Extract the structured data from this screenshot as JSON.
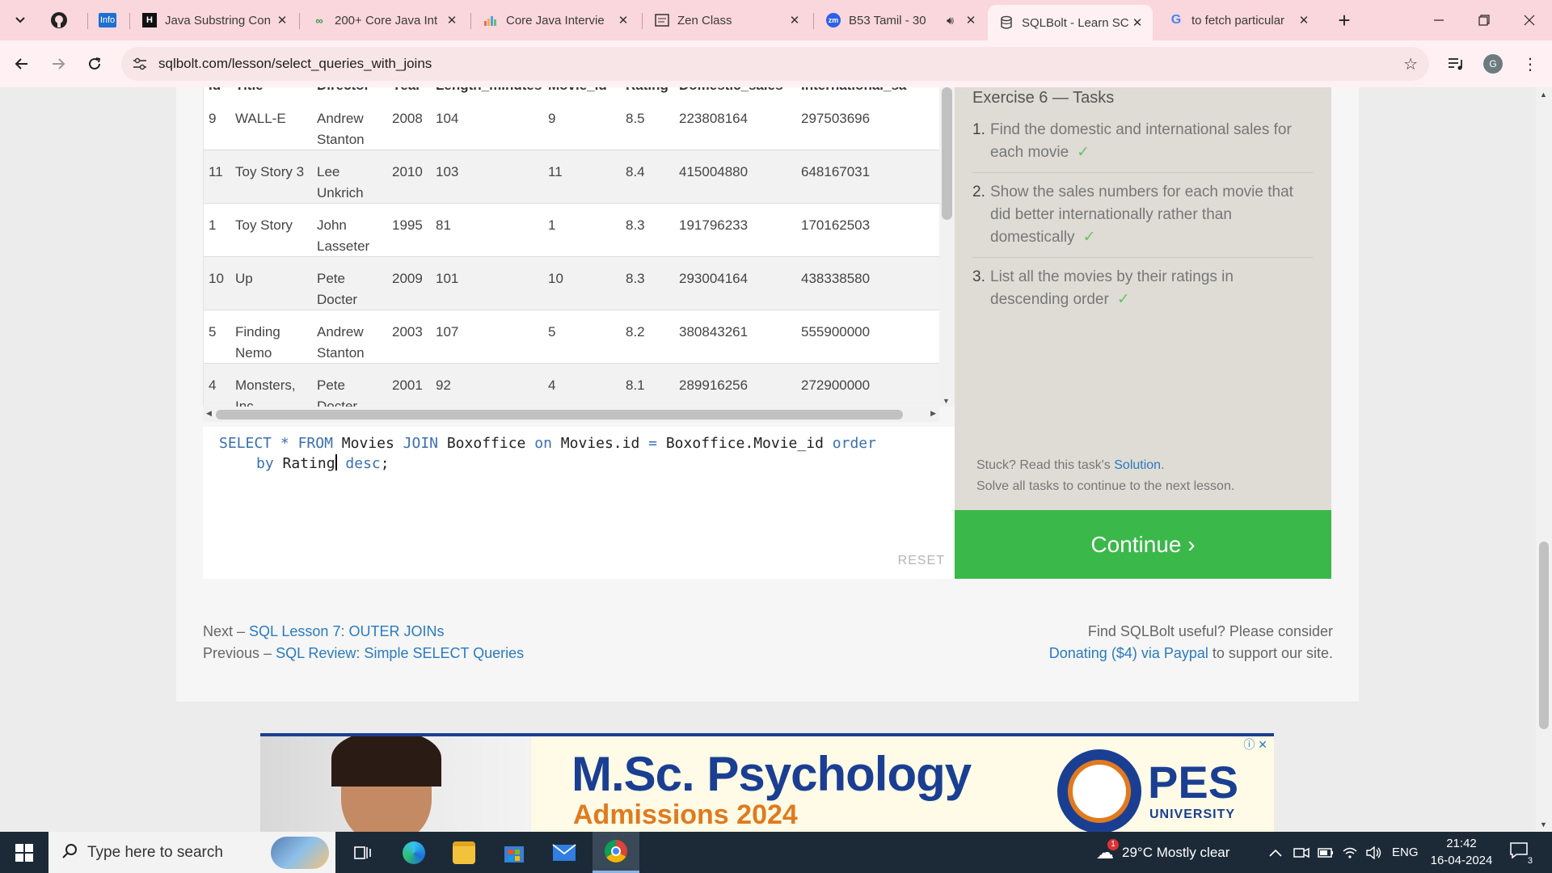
{
  "browser": {
    "tabs": [
      {
        "title": "Java Substring Con",
        "favicon": "letter-mark-icon"
      },
      {
        "title": "200+ Core Java Int",
        "favicon": "link-icon"
      },
      {
        "title": "Core Java Intervie",
        "favicon": "chart-icon"
      },
      {
        "title": "Zen Class",
        "favicon": "document-icon"
      },
      {
        "title": "B53 Tamil - 30",
        "favicon": "zoom-icon",
        "badge": "zm"
      },
      {
        "title": "SQLBolt - Learn SC",
        "favicon": "database-icon",
        "active": true
      },
      {
        "title": "to fetch particular",
        "favicon": "google-icon"
      }
    ],
    "pinned_info_label": "Info",
    "new_tab_label": "+",
    "url": "sqlbolt.com/lesson/select_queries_with_joins",
    "profile_initial": "G"
  },
  "results": {
    "headers": [
      "Id",
      "Title",
      "Director",
      "Year",
      "Length_minutes",
      "Movie_id",
      "Rating",
      "Domestic_sales",
      "International_sa"
    ],
    "rows": [
      {
        "id": "9",
        "title": "WALL-E",
        "director": "Andrew Stanton",
        "year": "2008",
        "length": "104",
        "movie_id": "9",
        "rating": "8.5",
        "domestic": "223808164",
        "intl": "297503696"
      },
      {
        "id": "11",
        "title": "Toy Story 3",
        "director": "Lee Unkrich",
        "year": "2010",
        "length": "103",
        "movie_id": "11",
        "rating": "8.4",
        "domestic": "415004880",
        "intl": "648167031"
      },
      {
        "id": "1",
        "title": "Toy Story",
        "director": "John Lasseter",
        "year": "1995",
        "length": "81",
        "movie_id": "1",
        "rating": "8.3",
        "domestic": "191796233",
        "intl": "170162503"
      },
      {
        "id": "10",
        "title": "Up",
        "director": "Pete Docter",
        "year": "2009",
        "length": "101",
        "movie_id": "10",
        "rating": "8.3",
        "domestic": "293004164",
        "intl": "438338580"
      },
      {
        "id": "5",
        "title": "Finding Nemo",
        "director": "Andrew Stanton",
        "year": "2003",
        "length": "107",
        "movie_id": "5",
        "rating": "8.2",
        "domestic": "380843261",
        "intl": "555900000"
      },
      {
        "id": "4",
        "title": "Monsters, Inc.",
        "director": "Pete Docter",
        "year": "2001",
        "length": "92",
        "movie_id": "4",
        "rating": "8.1",
        "domestic": "289916256",
        "intl": "272900000"
      }
    ]
  },
  "editor": {
    "line1": [
      "SELECT",
      "*",
      "FROM",
      "Movies",
      "JOIN",
      "Boxoffice",
      "on",
      "Movies.id",
      "=",
      "Boxoffice.Movie_id",
      "order"
    ],
    "line2": [
      "by",
      "Rating",
      "desc",
      ";"
    ],
    "reset_label": "RESET"
  },
  "tasks": {
    "title": "Exercise 6 — Tasks",
    "items": [
      {
        "num": "1.",
        "text": "Find the domestic and international sales for each movie",
        "check": "✓"
      },
      {
        "num": "2.",
        "text": "Show the sales numbers for each movie that did better internationally rather than domestically",
        "check": "✓"
      },
      {
        "num": "3.",
        "text": "List all the movies by their ratings in descending order",
        "check": "✓"
      }
    ],
    "stuck_text": "Stuck? Read this task's",
    "solution_link": "Solution",
    "solve_all_text": "Solve all tasks to continue to the next lesson.",
    "continue_label": "Continue ›"
  },
  "pager": {
    "next_prefix": "Next –",
    "next_link": "SQL Lesson 7: OUTER JOINs",
    "prev_prefix": "Previous –",
    "prev_link": "SQL Review: Simple SELECT Queries",
    "donate_line1": "Find SQLBolt useful? Please consider",
    "donate_link": "Donating ($4) via Paypal",
    "donate_suffix": "to support our site."
  },
  "ad": {
    "headline": "M.Sc. Psychology",
    "subline": "Admissions 2024",
    "brand": "PES",
    "brand_sub": "UNIVERSITY"
  },
  "taskbar": {
    "search_placeholder": "Type here to search",
    "weather": "29°C  Mostly clear",
    "weather_badge": "1",
    "language": "ENG",
    "time": "21:42",
    "date": "16-04-2024",
    "notifications": "3"
  },
  "colors": {
    "tabbar": "#fad7dc",
    "accent_green": "#3bb84a",
    "link_blue": "#2a7ac0",
    "sql_keyword": "#3a6fb0"
  }
}
